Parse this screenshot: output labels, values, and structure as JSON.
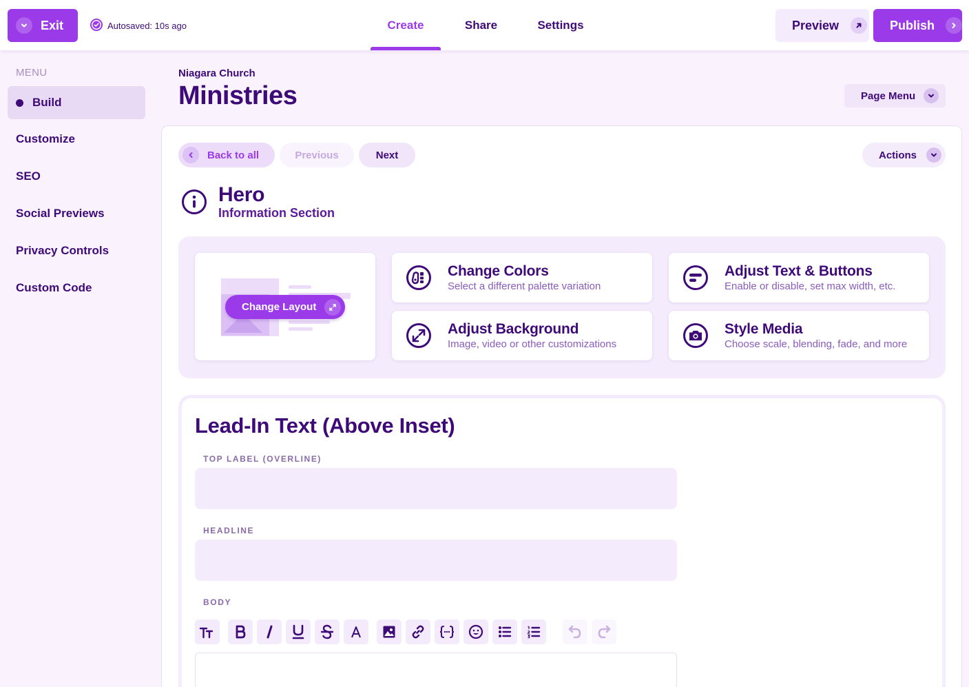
{
  "topbar": {
    "exit_label": "Exit",
    "autosave": "Autosaved: 10s ago",
    "tabs": [
      {
        "label": "Create",
        "active": true
      },
      {
        "label": "Share",
        "active": false
      },
      {
        "label": "Settings",
        "active": false
      }
    ],
    "preview_label": "Preview",
    "publish_label": "Publish"
  },
  "sidebar": {
    "heading": "MENU",
    "items": [
      {
        "label": "Build",
        "active": true
      },
      {
        "label": "Customize",
        "active": false
      },
      {
        "label": "SEO",
        "active": false
      },
      {
        "label": "Social Previews",
        "active": false
      },
      {
        "label": "Privacy Controls",
        "active": false
      },
      {
        "label": "Custom Code",
        "active": false
      }
    ]
  },
  "page": {
    "org": "Niagara Church",
    "title": "Ministries",
    "page_menu_label": "Page Menu"
  },
  "nav": {
    "back_label": "Back to all",
    "previous_label": "Previous",
    "next_label": "Next",
    "actions_label": "Actions"
  },
  "section": {
    "title": "Hero",
    "subtitle": "Information Section"
  },
  "tools": {
    "change_layout_label": "Change Layout",
    "cards": [
      {
        "title": "Change Colors",
        "desc": "Select a different palette variation",
        "icon": "palette-icon"
      },
      {
        "title": "Adjust Text & Buttons",
        "desc": "Enable or disable, set max width, etc.",
        "icon": "text-buttons-icon"
      },
      {
        "title": "Adjust Background",
        "desc": "Image, video or other customizations",
        "icon": "expand-arrows-icon"
      },
      {
        "title": "Style Media",
        "desc": "Choose scale, blending, fade, and more",
        "icon": "camera-icon"
      }
    ]
  },
  "lead_in": {
    "title": "Lead-In Text (Above Inset)",
    "top_label": "TOP LABEL (OVERLINE)",
    "top_label_value": "",
    "headline_label": "HEADLINE",
    "headline_value": "",
    "body_label": "BODY"
  },
  "toolbar_icons": [
    "text-size-icon",
    "bold-icon",
    "italic-icon",
    "underline-icon",
    "strikethrough-icon",
    "font-color-icon",
    "image-icon",
    "link-icon",
    "code-braces-icon",
    "emoji-icon",
    "bullet-list-icon",
    "numbered-list-icon",
    "undo-icon",
    "redo-icon"
  ],
  "colors": {
    "accent": "#9a3ae8",
    "text": "#3d0a78",
    "muted_text": "#8a5cbd",
    "soft_bg": "#f4ebfd"
  }
}
